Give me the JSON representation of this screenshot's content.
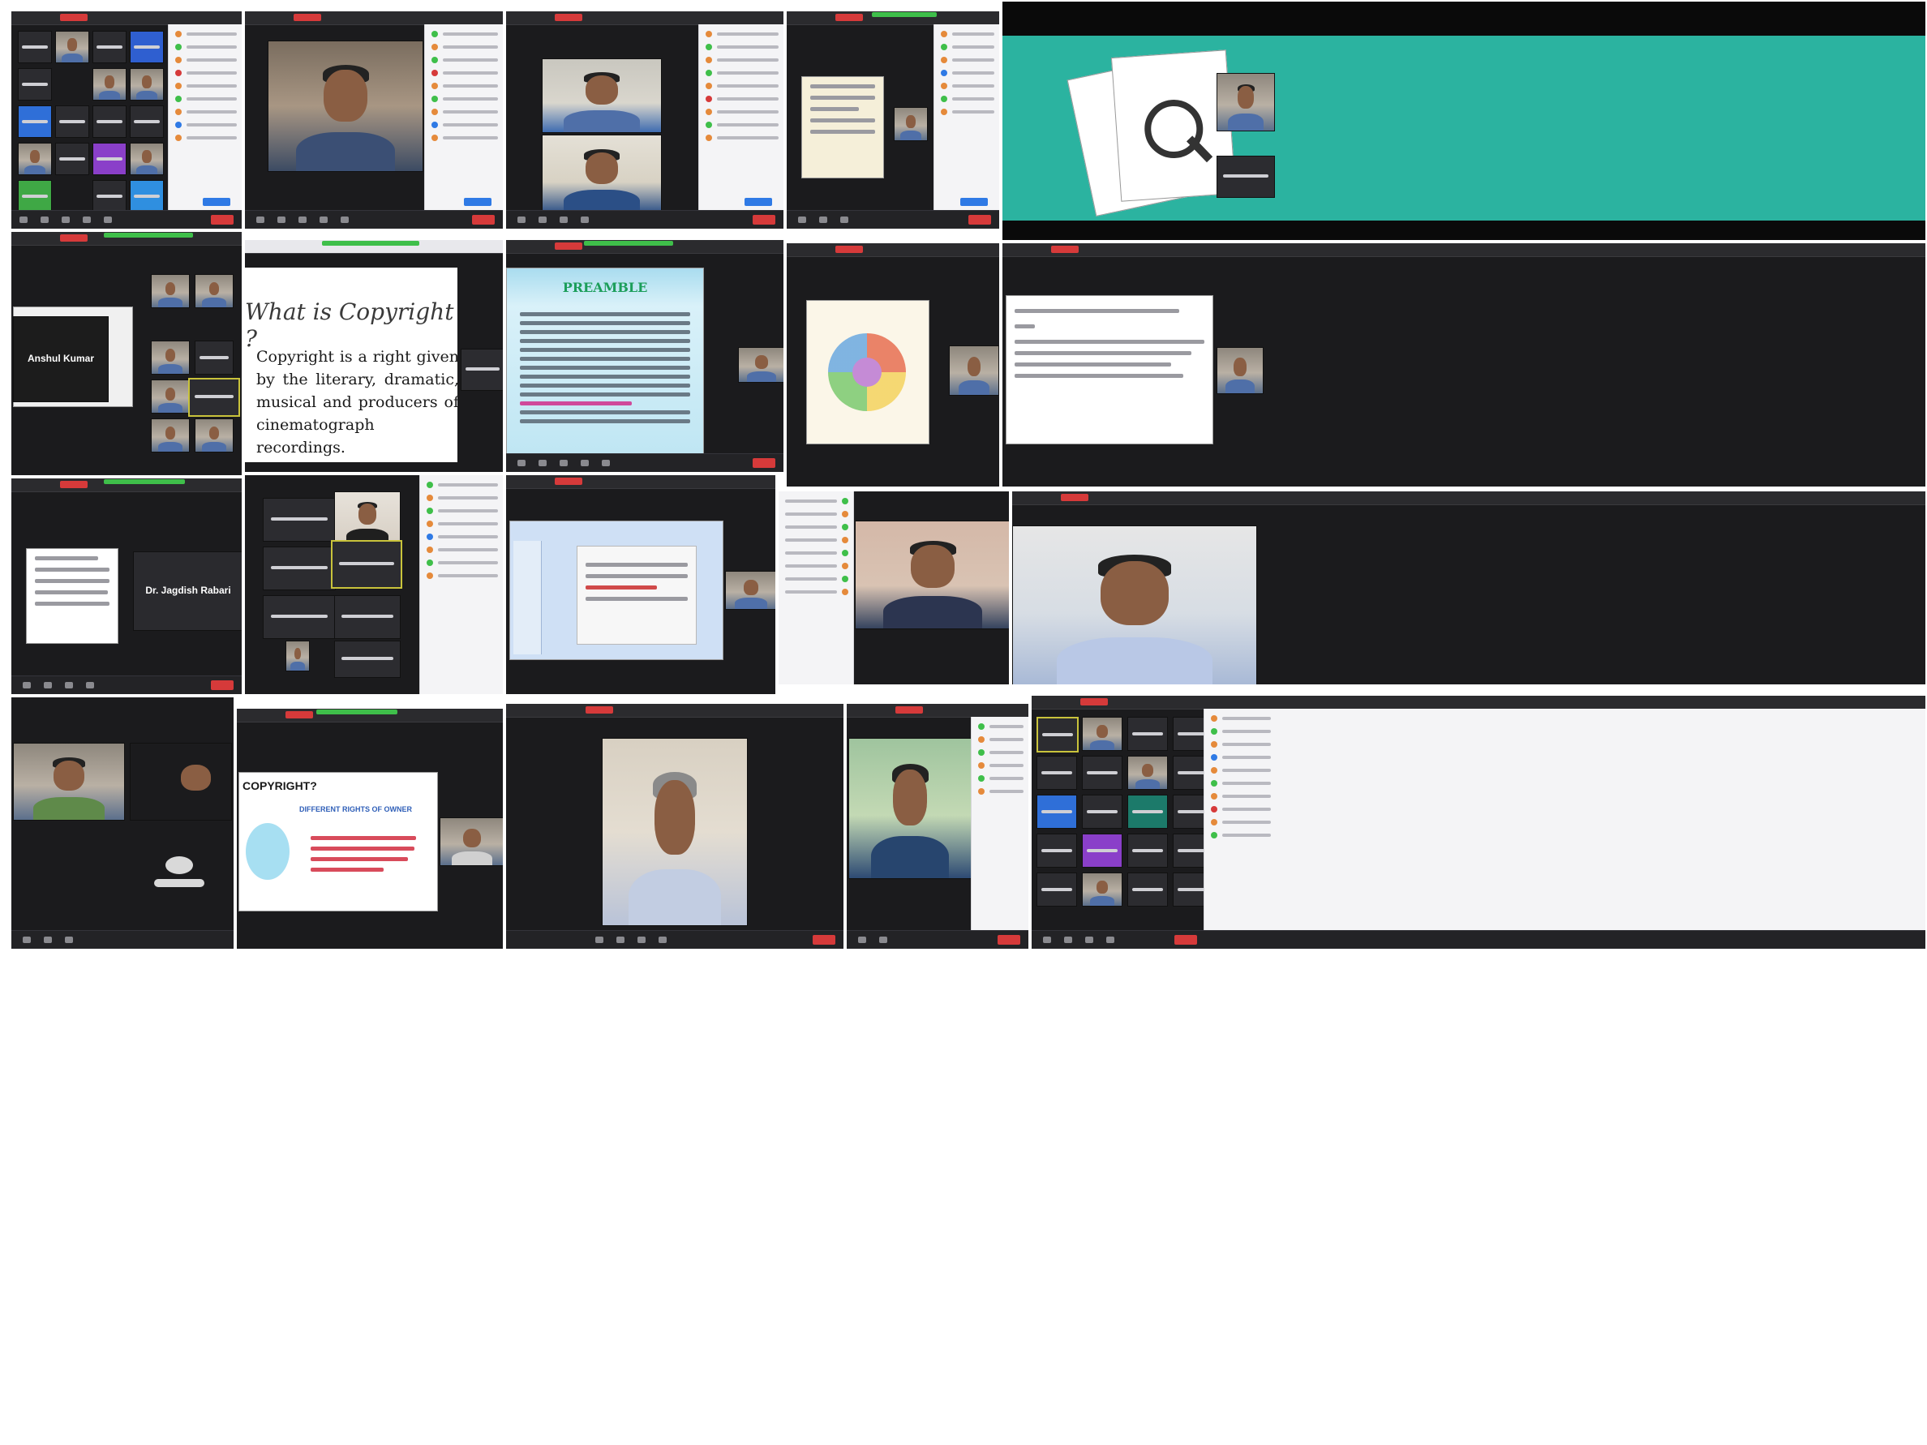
{
  "collage": {
    "description_free": true,
    "screens": [
      {
        "id": "top-1",
        "type": "participant-gallery"
      },
      {
        "id": "top-2",
        "type": "speaker-view"
      },
      {
        "id": "top-3",
        "type": "speaker-view"
      },
      {
        "id": "top-4",
        "type": "shared-document"
      },
      {
        "id": "top-5",
        "type": "shared-slide"
      },
      {
        "id": "mid-1",
        "type": "speaker-name-tile"
      },
      {
        "id": "mid-2",
        "type": "shared-slide"
      },
      {
        "id": "mid-3",
        "type": "shared-slide"
      },
      {
        "id": "mid-4",
        "type": "shared-diagram"
      },
      {
        "id": "mid-5",
        "type": "shared-slide"
      },
      {
        "id": "row3-1",
        "type": "speaker-name-tile"
      },
      {
        "id": "row3-2",
        "type": "participant-gallery"
      },
      {
        "id": "row3-3",
        "type": "shared-presentation-editor"
      },
      {
        "id": "row3-4",
        "type": "speaker-view"
      },
      {
        "id": "row3-5",
        "type": "speaker-view"
      },
      {
        "id": "bot-1",
        "type": "speaker-view"
      },
      {
        "id": "bot-2",
        "type": "shared-slide"
      },
      {
        "id": "bot-3",
        "type": "speaker-view"
      },
      {
        "id": "bot-4",
        "type": "speaker-view"
      },
      {
        "id": "bot-5",
        "type": "participant-gallery"
      }
    ]
  },
  "slides": {
    "copyright_title": "What is Copyright ?",
    "copyright_body": "Copyright is a right given by the literary, dramatic, musical and producers of cinematograph recordings.",
    "preamble_title": "PREAMBLE",
    "copyright2_title": "COPYRIGHT?",
    "copyright2_subtitle": "DIFFERENT RIGHTS OF OWNER"
  },
  "name_tiles": {
    "mid1_name": "Anshul Kumar",
    "row3_name": "Dr. Jagdish Rabari"
  },
  "colors": {
    "zoom_dark": "#1b1b1d",
    "record_red": "#d63a3a",
    "active_green": "#3fbf4a",
    "teal_slide": "#2bb3a0",
    "preamble_blue": "#bfe6f3"
  }
}
